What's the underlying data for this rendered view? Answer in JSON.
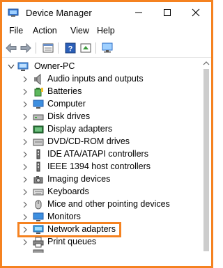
{
  "window": {
    "title": "Device Manager",
    "accent": "#f58220"
  },
  "menu": {
    "file": "File",
    "action": "Action",
    "view": "View",
    "help": "Help"
  },
  "toolbar": {
    "icons": [
      "back-icon",
      "forward-icon",
      "properties-icon",
      "help-icon",
      "update-driver-icon",
      "scan-hardware-icon"
    ]
  },
  "tree": {
    "root": "Owner-PC",
    "items": [
      {
        "label": "Audio inputs and outputs",
        "icon": "speaker-icon"
      },
      {
        "label": "Batteries",
        "icon": "battery-icon"
      },
      {
        "label": "Computer",
        "icon": "computer-icon"
      },
      {
        "label": "Disk drives",
        "icon": "disk-drive-icon"
      },
      {
        "label": "Display adapters",
        "icon": "display-adapter-icon"
      },
      {
        "label": "DVD/CD-ROM drives",
        "icon": "dvd-icon"
      },
      {
        "label": "IDE ATA/ATAPI controllers",
        "icon": "ide-controller-icon"
      },
      {
        "label": "IEEE 1394 host controllers",
        "icon": "ieee1394-icon"
      },
      {
        "label": "Imaging devices",
        "icon": "camera-icon"
      },
      {
        "label": "Keyboards",
        "icon": "keyboard-icon"
      },
      {
        "label": "Mice and other pointing devices",
        "icon": "mouse-icon"
      },
      {
        "label": "Monitors",
        "icon": "monitor-icon"
      },
      {
        "label": "Network adapters",
        "icon": "network-adapter-icon"
      },
      {
        "label": "Print queues",
        "icon": "printer-icon"
      }
    ]
  }
}
